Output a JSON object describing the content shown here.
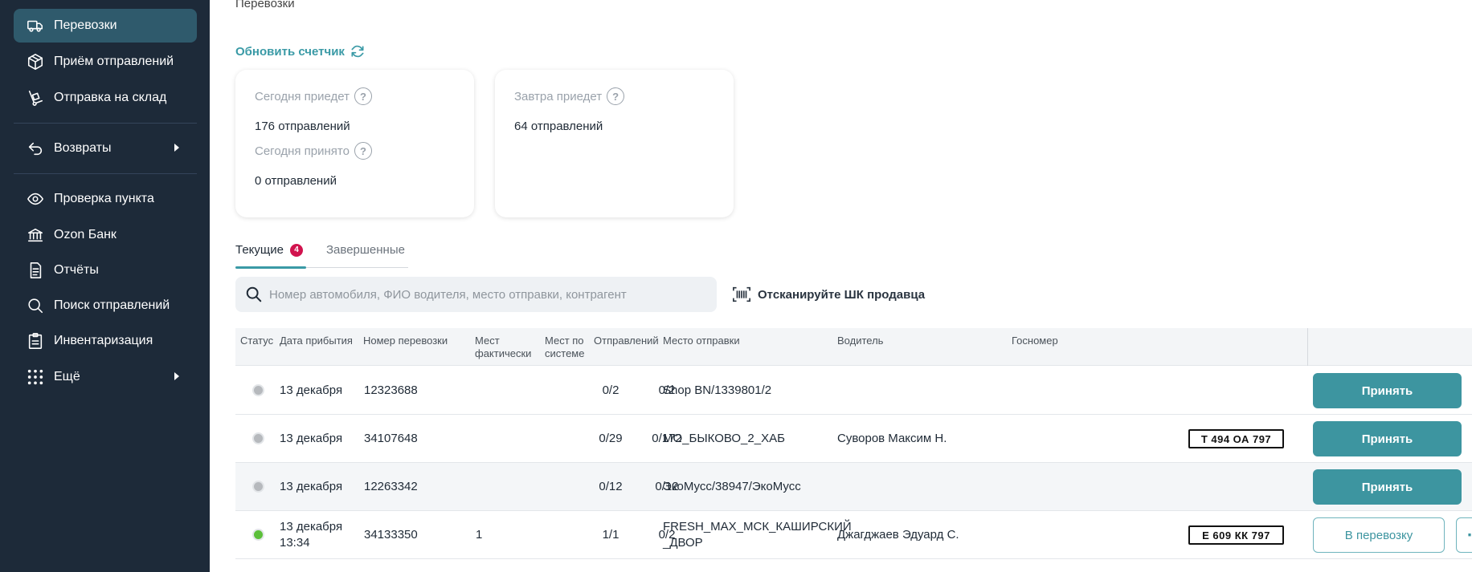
{
  "sidebar": {
    "items": [
      {
        "label": "Перевозки",
        "icon": "truck-icon"
      },
      {
        "label": "Приём отправлений",
        "icon": "box-icon"
      },
      {
        "label": "Отправка на склад",
        "icon": "hand-truck-icon"
      },
      {
        "label": "Возвраты",
        "icon": "return-icon"
      },
      {
        "label": "Проверка пункта",
        "icon": "eye-icon"
      },
      {
        "label": "Ozon Банк",
        "icon": "bank-icon"
      },
      {
        "label": "Отчёты",
        "icon": "document-icon"
      },
      {
        "label": "Поиск отправлений",
        "icon": "search-icon"
      },
      {
        "label": "Инвентаризация",
        "icon": "clipboard-icon"
      },
      {
        "label": "Ещё",
        "icon": "grid-dots-icon"
      }
    ]
  },
  "header": {
    "breadcrumb": "Перевозки",
    "refresh_label": "Обновить счетчик"
  },
  "cards": {
    "today": {
      "arrive_label": "Сегодня приедет",
      "arrive_value": "176 отправлений",
      "accepted_label": "Сегодня принято",
      "accepted_value": "0 отправлений"
    },
    "tomorrow": {
      "arrive_label": "Завтра приедет",
      "arrive_value": "64 отправлений"
    }
  },
  "tabs": {
    "current_label": "Текущие",
    "current_badge": "4",
    "finished_label": "Завершенные"
  },
  "search": {
    "placeholder": "Номер автомобиля, ФИО водителя, место отправки, контрагент",
    "scan_label": "Отсканируйте ШК продавца"
  },
  "table": {
    "headers": {
      "status": "Статус",
      "arrival": "Дата прибытия",
      "number": "Номер перевозки",
      "places_actual_1": "Мест",
      "places_actual_2": "фактически",
      "places_system_1": "Мест по",
      "places_system_2": "системе",
      "shipments": "Отправлений",
      "origin": "Место отправки",
      "driver": "Водитель",
      "plate": "Госномер"
    },
    "rows": [
      {
        "status_color": "#b6b9bd",
        "date": "13 декабря",
        "time": "",
        "number": "12323688",
        "places_actual": "",
        "places_system": "0/2",
        "shipments": "0/2",
        "origin_1": "Shop BN/1339801/2",
        "origin_2": "",
        "driver": "",
        "plate": "",
        "action": "Принять"
      },
      {
        "status_color": "#b6b9bd",
        "date": "13 декабря",
        "time": "",
        "number": "34107648",
        "places_actual": "",
        "places_system": "0/29",
        "shipments": "0/172",
        "origin_1": "МО_БЫКОВО_2_ХАБ",
        "origin_2": "",
        "driver": "Суворов Максим Н.",
        "plate": "Т 494 ОА 797",
        "action": "Принять"
      },
      {
        "status_color": "#b6b9bd",
        "date": "13 декабря",
        "time": "",
        "number": "12263342",
        "places_actual": "",
        "places_system": "0/12",
        "shipments": "0/12",
        "origin_1": "ЭкоМусс/38947/ЭкоМусс",
        "origin_2": "",
        "driver": "",
        "plate": "",
        "action": "Принять"
      },
      {
        "status_color": "#5cbf3a",
        "date": "13 декабря",
        "time": "13:34",
        "number": "34133350",
        "places_actual": "1",
        "places_system": "1/1",
        "shipments": "0/2",
        "origin_1": "FRESH_MAX_МСК_КАШИРСКИЙ",
        "origin_2": "_ДВОР",
        "driver": "Джагджаев Эдуард С.",
        "plate": "Е 609 КК 797",
        "action": "В перевозку",
        "more": "⋯"
      }
    ]
  }
}
